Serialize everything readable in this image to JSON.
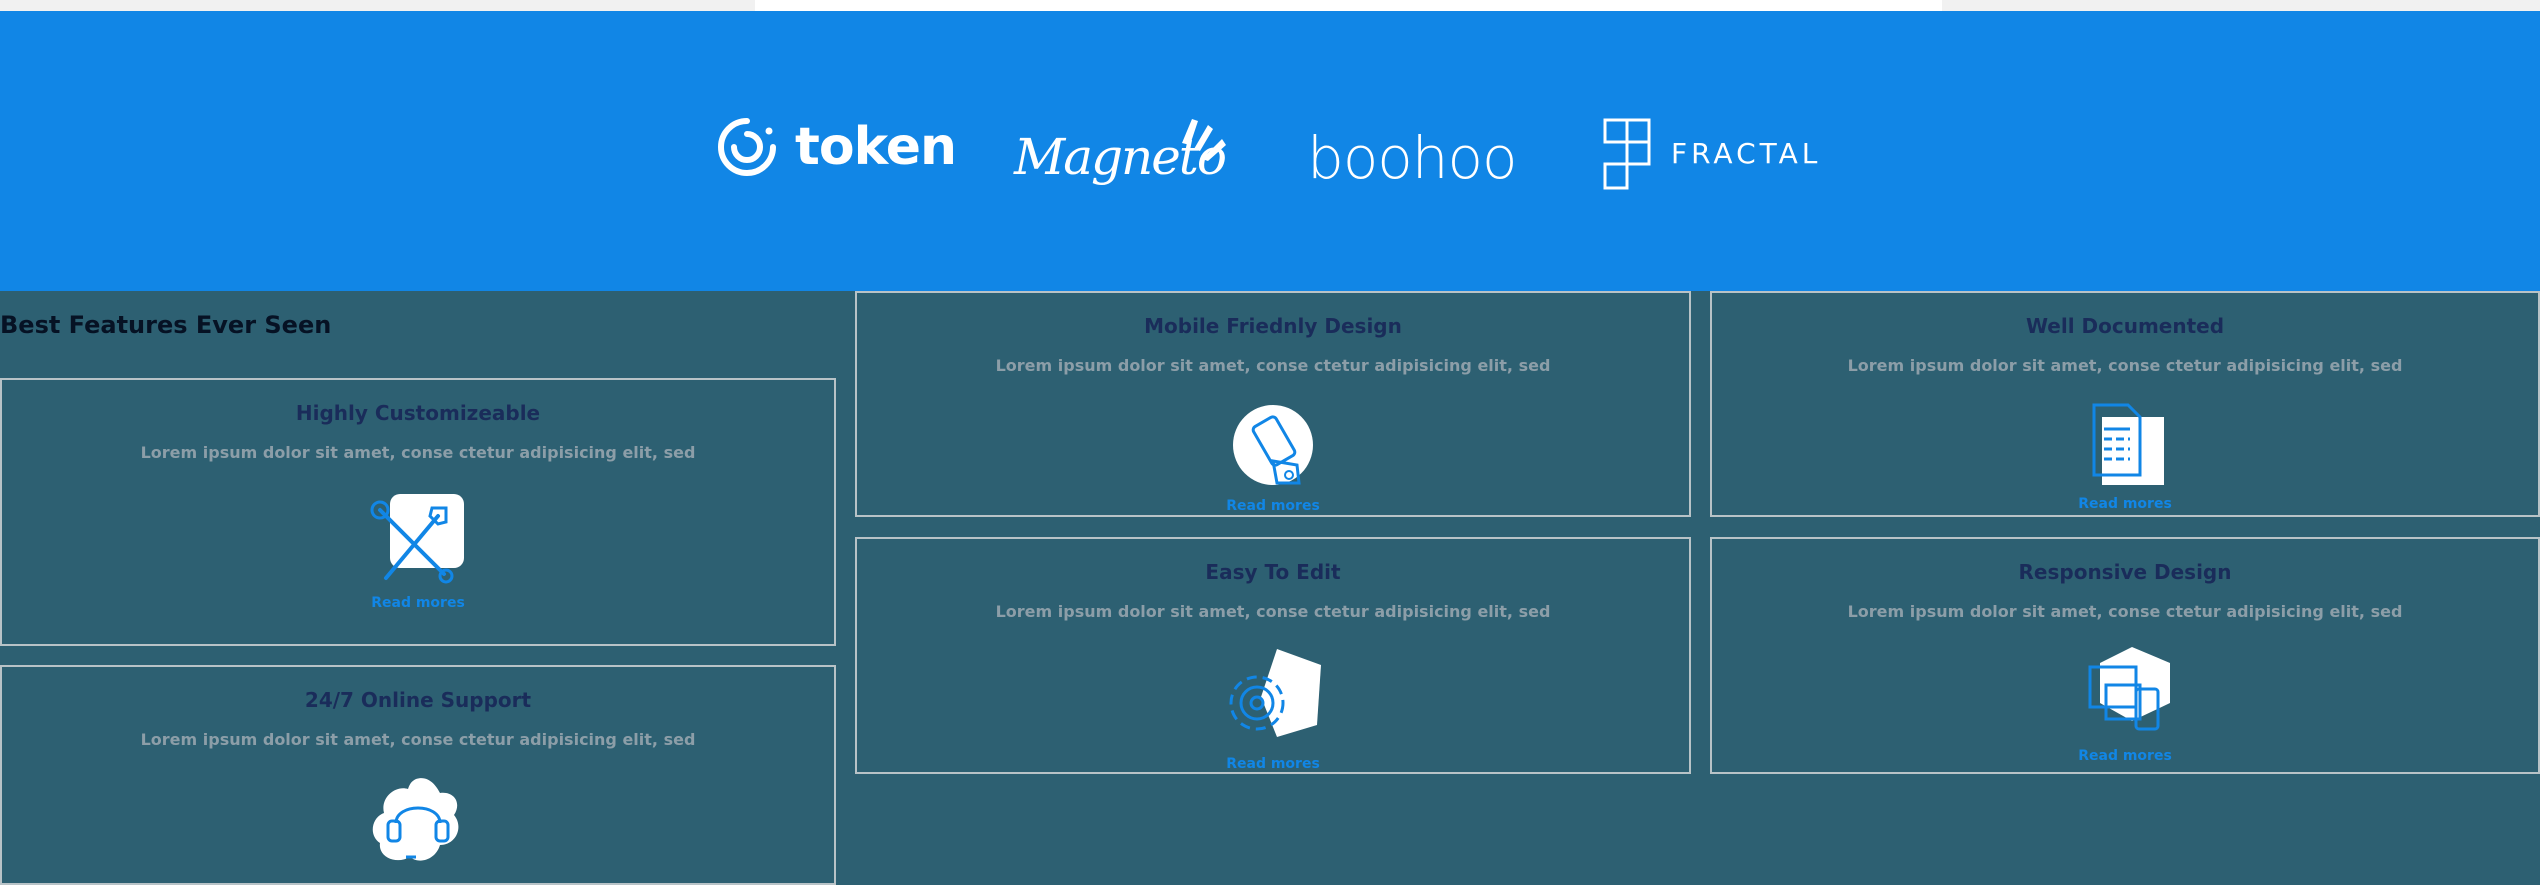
{
  "logos": [
    {
      "icon": "token-logo-icon",
      "text": "token"
    },
    {
      "icon": "magneto-logo-icon",
      "text": "Magneto"
    },
    {
      "icon": "boohoo-logo",
      "text": "boohoo"
    },
    {
      "icon": "fractal-logo-icon",
      "text": "FRACTAL"
    }
  ],
  "section": {
    "title": "Best Features Ever Seen"
  },
  "colors": {
    "band": "#1186e6",
    "section_bg": "#2d6072",
    "link": "#1186e6"
  },
  "features": [
    {
      "title": "Highly Customizeable",
      "desc": "Lorem ipsum dolor sit amet, conse ctetur adipisicing elit, sed",
      "icon": "tools-icon",
      "link": "Read mores"
    },
    {
      "title": "Mobile Friednly Design",
      "desc": "Lorem ipsum dolor sit amet, conse ctetur adipisicing elit, sed",
      "icon": "mobile-icon",
      "link": "Read mores"
    },
    {
      "title": "Well Documented",
      "desc": "Lorem ipsum dolor sit amet, conse ctetur adipisicing elit, sed",
      "icon": "document-icon",
      "link": "Read mores"
    },
    {
      "title": "Easy To Edit",
      "desc": "Lorem ipsum dolor sit amet, conse ctetur adipisicing elit, sed",
      "icon": "gear-icon",
      "link": "Read mores"
    },
    {
      "title": "Responsive Design",
      "desc": "Lorem ipsum dolor sit amet, conse ctetur adipisicing elit, sed",
      "icon": "devices-icon",
      "link": "Read mores"
    },
    {
      "title": "24/7 Online Support",
      "desc": "Lorem ipsum dolor sit amet, conse ctetur adipisicing elit, sed",
      "icon": "headset-icon",
      "link": ""
    }
  ]
}
